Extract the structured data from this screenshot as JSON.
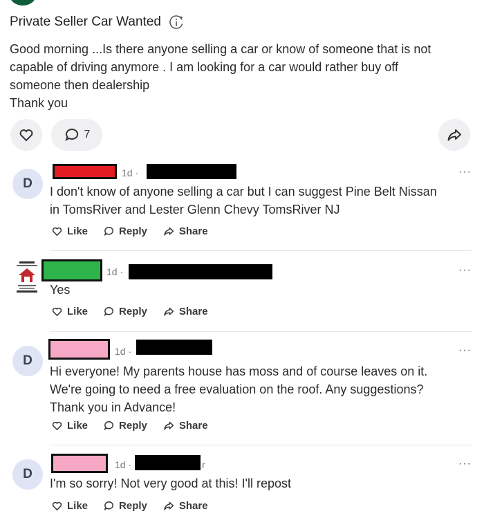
{
  "post": {
    "title": "Private Seller Car Wanted",
    "body_lines": [
      "Good morning ...Is there anyone selling a car or know of someone that is not",
      "capable of driving anymore .  I am looking for a car would rather buy off",
      "someone then dealership",
      "Thank you"
    ],
    "comment_count": "7"
  },
  "comments": [
    {
      "avatar_letter": "D",
      "time": "1d ·",
      "text_lines": [
        "I don't know of anyone selling a car but I can suggest Pine Belt Nissan",
        "in TomsRiver and Lester Glenn Chevy TomsRiver NJ"
      ],
      "name_color": "#e31b23"
    },
    {
      "avatar_letter": "",
      "time": "1d ·",
      "text_lines": [
        "Yes"
      ],
      "name_color": "#2eb44a"
    },
    {
      "avatar_letter": "D",
      "time": "1d ·",
      "text_lines": [
        "Hi everyone!  My parents house has moss and of course leaves on it.",
        "We're going to need a free evaluation on the roof.  Any suggestions?",
        "Thank you in Advance!"
      ],
      "name_color": "#f7a8c4"
    },
    {
      "avatar_letter": "D",
      "time": "1d ·",
      "text_lines": [
        "I'm so sorry!  Not very good at this!  I'll repost"
      ],
      "name_color": "#f7a8c4",
      "trailing_char": "r"
    }
  ],
  "actions": {
    "like": "Like",
    "reply": "Reply",
    "share": "Share"
  },
  "menu_glyph": "···",
  "icons": {
    "info": "info-sparkle-icon",
    "heart": "heart-icon",
    "comment": "comment-bubble-icon",
    "share": "share-arrow-icon"
  }
}
